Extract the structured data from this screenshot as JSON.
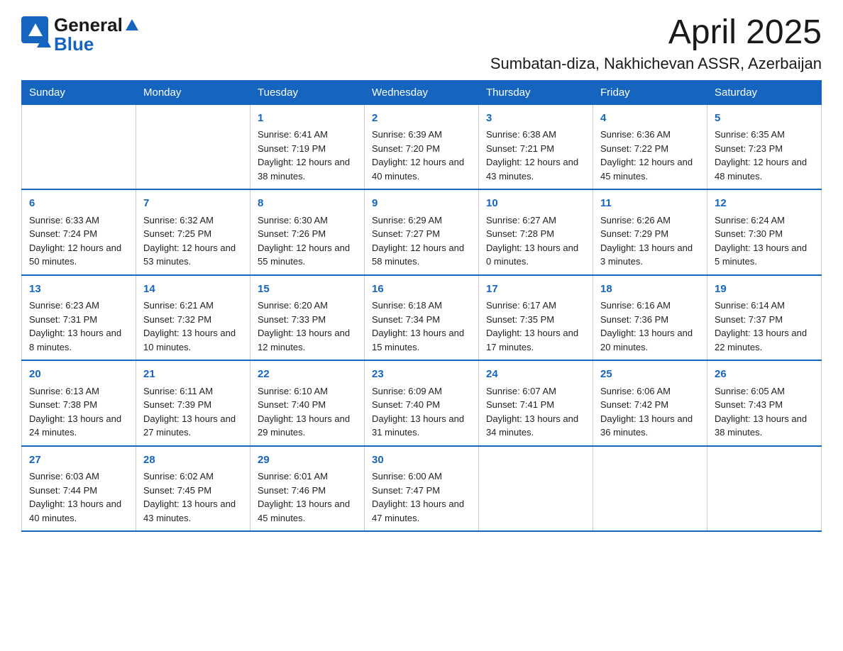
{
  "header": {
    "logo_general": "General",
    "logo_blue": "Blue",
    "month_title": "April 2025",
    "location": "Sumbatan-diza, Nakhichevan ASSR, Azerbaijan"
  },
  "days_of_week": [
    "Sunday",
    "Monday",
    "Tuesday",
    "Wednesday",
    "Thursday",
    "Friday",
    "Saturday"
  ],
  "weeks": [
    [
      {
        "day": "",
        "sunrise": "",
        "sunset": "",
        "daylight": ""
      },
      {
        "day": "",
        "sunrise": "",
        "sunset": "",
        "daylight": ""
      },
      {
        "day": "1",
        "sunrise": "Sunrise: 6:41 AM",
        "sunset": "Sunset: 7:19 PM",
        "daylight": "Daylight: 12 hours and 38 minutes."
      },
      {
        "day": "2",
        "sunrise": "Sunrise: 6:39 AM",
        "sunset": "Sunset: 7:20 PM",
        "daylight": "Daylight: 12 hours and 40 minutes."
      },
      {
        "day": "3",
        "sunrise": "Sunrise: 6:38 AM",
        "sunset": "Sunset: 7:21 PM",
        "daylight": "Daylight: 12 hours and 43 minutes."
      },
      {
        "day": "4",
        "sunrise": "Sunrise: 6:36 AM",
        "sunset": "Sunset: 7:22 PM",
        "daylight": "Daylight: 12 hours and 45 minutes."
      },
      {
        "day": "5",
        "sunrise": "Sunrise: 6:35 AM",
        "sunset": "Sunset: 7:23 PM",
        "daylight": "Daylight: 12 hours and 48 minutes."
      }
    ],
    [
      {
        "day": "6",
        "sunrise": "Sunrise: 6:33 AM",
        "sunset": "Sunset: 7:24 PM",
        "daylight": "Daylight: 12 hours and 50 minutes."
      },
      {
        "day": "7",
        "sunrise": "Sunrise: 6:32 AM",
        "sunset": "Sunset: 7:25 PM",
        "daylight": "Daylight: 12 hours and 53 minutes."
      },
      {
        "day": "8",
        "sunrise": "Sunrise: 6:30 AM",
        "sunset": "Sunset: 7:26 PM",
        "daylight": "Daylight: 12 hours and 55 minutes."
      },
      {
        "day": "9",
        "sunrise": "Sunrise: 6:29 AM",
        "sunset": "Sunset: 7:27 PM",
        "daylight": "Daylight: 12 hours and 58 minutes."
      },
      {
        "day": "10",
        "sunrise": "Sunrise: 6:27 AM",
        "sunset": "Sunset: 7:28 PM",
        "daylight": "Daylight: 13 hours and 0 minutes."
      },
      {
        "day": "11",
        "sunrise": "Sunrise: 6:26 AM",
        "sunset": "Sunset: 7:29 PM",
        "daylight": "Daylight: 13 hours and 3 minutes."
      },
      {
        "day": "12",
        "sunrise": "Sunrise: 6:24 AM",
        "sunset": "Sunset: 7:30 PM",
        "daylight": "Daylight: 13 hours and 5 minutes."
      }
    ],
    [
      {
        "day": "13",
        "sunrise": "Sunrise: 6:23 AM",
        "sunset": "Sunset: 7:31 PM",
        "daylight": "Daylight: 13 hours and 8 minutes."
      },
      {
        "day": "14",
        "sunrise": "Sunrise: 6:21 AM",
        "sunset": "Sunset: 7:32 PM",
        "daylight": "Daylight: 13 hours and 10 minutes."
      },
      {
        "day": "15",
        "sunrise": "Sunrise: 6:20 AM",
        "sunset": "Sunset: 7:33 PM",
        "daylight": "Daylight: 13 hours and 12 minutes."
      },
      {
        "day": "16",
        "sunrise": "Sunrise: 6:18 AM",
        "sunset": "Sunset: 7:34 PM",
        "daylight": "Daylight: 13 hours and 15 minutes."
      },
      {
        "day": "17",
        "sunrise": "Sunrise: 6:17 AM",
        "sunset": "Sunset: 7:35 PM",
        "daylight": "Daylight: 13 hours and 17 minutes."
      },
      {
        "day": "18",
        "sunrise": "Sunrise: 6:16 AM",
        "sunset": "Sunset: 7:36 PM",
        "daylight": "Daylight: 13 hours and 20 minutes."
      },
      {
        "day": "19",
        "sunrise": "Sunrise: 6:14 AM",
        "sunset": "Sunset: 7:37 PM",
        "daylight": "Daylight: 13 hours and 22 minutes."
      }
    ],
    [
      {
        "day": "20",
        "sunrise": "Sunrise: 6:13 AM",
        "sunset": "Sunset: 7:38 PM",
        "daylight": "Daylight: 13 hours and 24 minutes."
      },
      {
        "day": "21",
        "sunrise": "Sunrise: 6:11 AM",
        "sunset": "Sunset: 7:39 PM",
        "daylight": "Daylight: 13 hours and 27 minutes."
      },
      {
        "day": "22",
        "sunrise": "Sunrise: 6:10 AM",
        "sunset": "Sunset: 7:40 PM",
        "daylight": "Daylight: 13 hours and 29 minutes."
      },
      {
        "day": "23",
        "sunrise": "Sunrise: 6:09 AM",
        "sunset": "Sunset: 7:40 PM",
        "daylight": "Daylight: 13 hours and 31 minutes."
      },
      {
        "day": "24",
        "sunrise": "Sunrise: 6:07 AM",
        "sunset": "Sunset: 7:41 PM",
        "daylight": "Daylight: 13 hours and 34 minutes."
      },
      {
        "day": "25",
        "sunrise": "Sunrise: 6:06 AM",
        "sunset": "Sunset: 7:42 PM",
        "daylight": "Daylight: 13 hours and 36 minutes."
      },
      {
        "day": "26",
        "sunrise": "Sunrise: 6:05 AM",
        "sunset": "Sunset: 7:43 PM",
        "daylight": "Daylight: 13 hours and 38 minutes."
      }
    ],
    [
      {
        "day": "27",
        "sunrise": "Sunrise: 6:03 AM",
        "sunset": "Sunset: 7:44 PM",
        "daylight": "Daylight: 13 hours and 40 minutes."
      },
      {
        "day": "28",
        "sunrise": "Sunrise: 6:02 AM",
        "sunset": "Sunset: 7:45 PM",
        "daylight": "Daylight: 13 hours and 43 minutes."
      },
      {
        "day": "29",
        "sunrise": "Sunrise: 6:01 AM",
        "sunset": "Sunset: 7:46 PM",
        "daylight": "Daylight: 13 hours and 45 minutes."
      },
      {
        "day": "30",
        "sunrise": "Sunrise: 6:00 AM",
        "sunset": "Sunset: 7:47 PM",
        "daylight": "Daylight: 13 hours and 47 minutes."
      },
      {
        "day": "",
        "sunrise": "",
        "sunset": "",
        "daylight": ""
      },
      {
        "day": "",
        "sunrise": "",
        "sunset": "",
        "daylight": ""
      },
      {
        "day": "",
        "sunrise": "",
        "sunset": "",
        "daylight": ""
      }
    ]
  ]
}
